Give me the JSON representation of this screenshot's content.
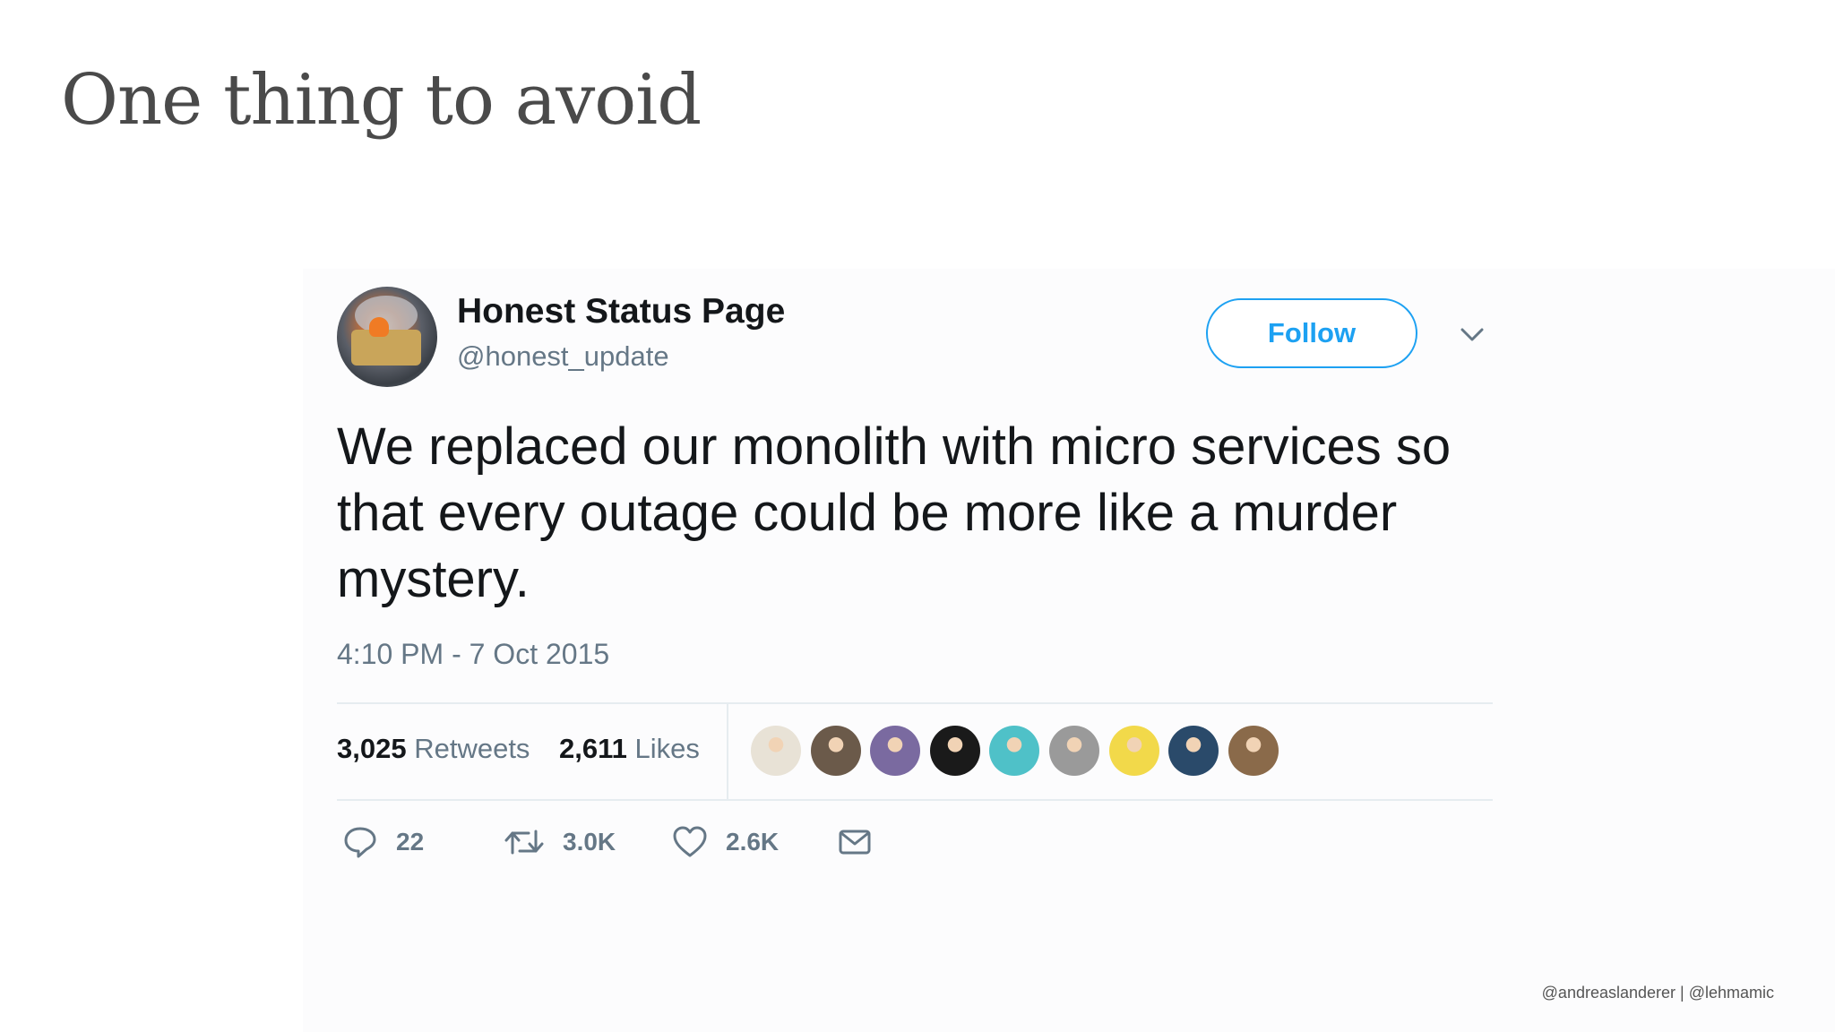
{
  "slide": {
    "title": "One thing to avoid",
    "footer": "@andreaslanderer | @lehmamic"
  },
  "tweet": {
    "user_name": "Honest Status Page",
    "user_handle": "@honest_update",
    "follow_label": "Follow",
    "text": "We replaced our monolith with micro services so that every outage could be more like a murder mystery.",
    "timestamp": "4:10 PM - 7 Oct 2015",
    "retweets_count": "3,025",
    "retweets_label": "Retweets",
    "likes_count": "2,611",
    "likes_label": "Likes",
    "actions": {
      "reply_count": "22",
      "retweet_count": "3.0K",
      "like_count": "2.6K"
    },
    "likers": [
      {
        "name": "liker-1",
        "color": "#e8e2d6"
      },
      {
        "name": "liker-2",
        "color": "#6b5a4a"
      },
      {
        "name": "liker-3",
        "color": "#7a6aa0"
      },
      {
        "name": "liker-4",
        "color": "#1a1a1a"
      },
      {
        "name": "liker-5",
        "color": "#4fc1c8"
      },
      {
        "name": "liker-6",
        "color": "#9a9a9a"
      },
      {
        "name": "liker-7",
        "color": "#f2d94a"
      },
      {
        "name": "liker-8",
        "color": "#2a4a6a"
      },
      {
        "name": "liker-9",
        "color": "#8a6a4a"
      }
    ],
    "colors": {
      "accent": "#1da1f2",
      "text": "#14171a",
      "muted": "#657786",
      "divider": "#e6ecf0"
    }
  }
}
